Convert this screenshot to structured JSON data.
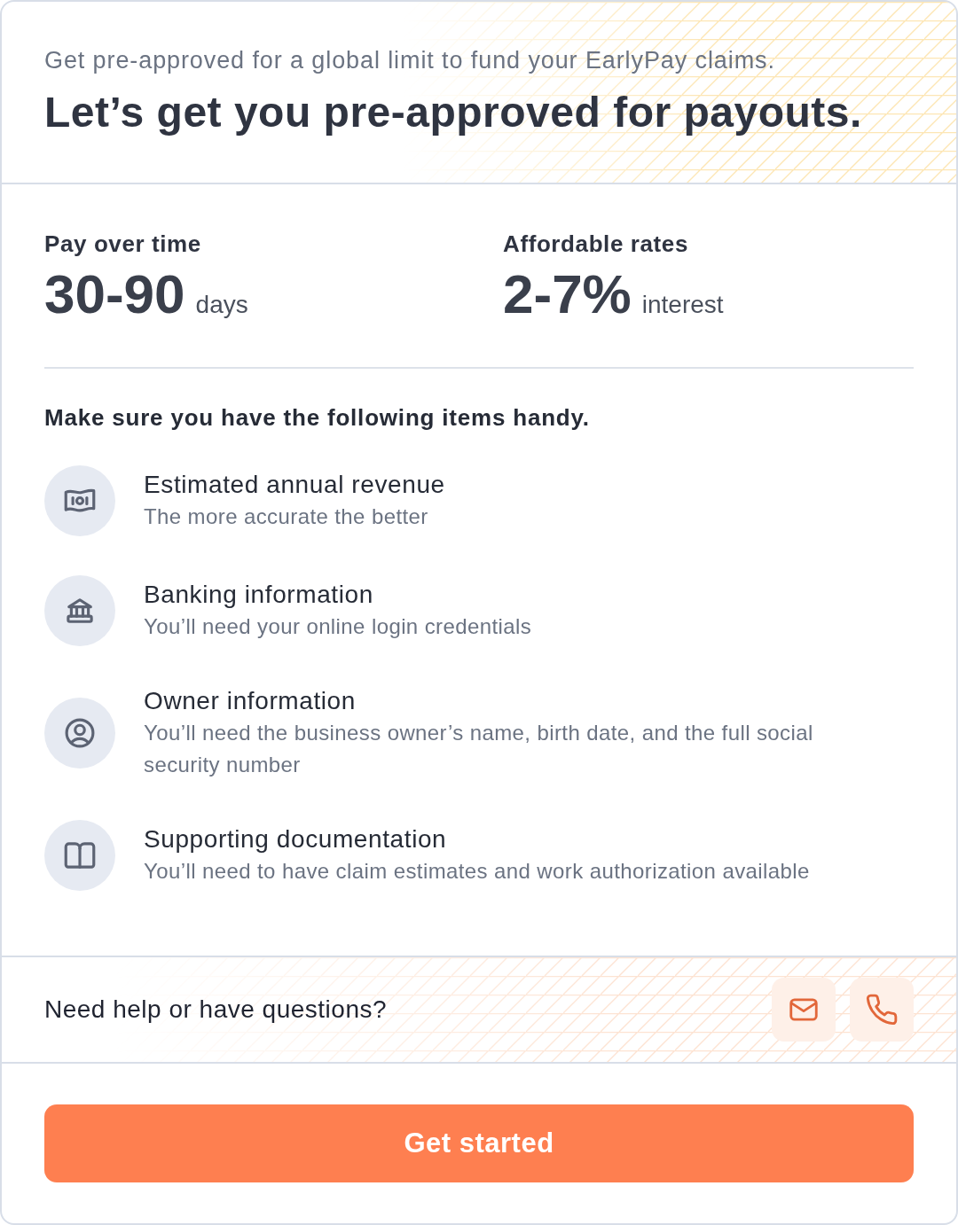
{
  "header": {
    "subtitle": "Get pre-approved for a global limit to fund your EarlyPay claims.",
    "title": "Let’s get you pre-approved for payouts."
  },
  "stats": [
    {
      "label": "Pay over time",
      "value": "30-90",
      "unit": "days"
    },
    {
      "label": "Affordable rates",
      "value": "2-7%",
      "unit": "interest"
    }
  ],
  "checklist": {
    "heading": "Make sure you have the following items handy.",
    "items": [
      {
        "kind": "money",
        "title": "Estimated annual revenue",
        "description": "The more accurate the better"
      },
      {
        "kind": "bank",
        "title": "Banking information",
        "description": "You’ll need your online login credentials"
      },
      {
        "kind": "person",
        "title": "Owner information",
        "description": "You’ll need the business owner’s name, birth date, and the full social security number"
      },
      {
        "kind": "book",
        "title": "Supporting documentation",
        "description": "You’ll need to have claim estimates and work authorization available"
      }
    ]
  },
  "help": {
    "text": "Need help or have questions?",
    "contact_buttons": [
      {
        "kind": "email"
      },
      {
        "kind": "phone"
      }
    ]
  },
  "cta": {
    "label": "Get started"
  }
}
